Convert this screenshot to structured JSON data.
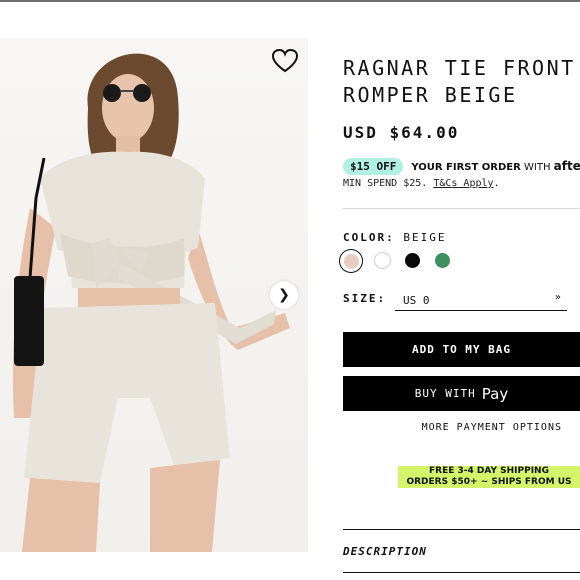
{
  "product": {
    "title": "RAGNAR TIE FRONT ROMPER BEIGE",
    "price": "USD $64.00"
  },
  "promo": {
    "badge": "$15 OFF",
    "text_prefix": "YOUR FIRST ORDER",
    "text_with": " WITH ",
    "brand": "afterp",
    "min_spend": "MIN SPEND $25.",
    "tcs_link": "T&Cs Apply",
    "tcs_end": "."
  },
  "color": {
    "label": "COLOR:",
    "selected": "BEIGE",
    "swatches": [
      "#e6cdbf",
      "#ffffff",
      "#0b0b0b",
      "#3f8f5f"
    ]
  },
  "size": {
    "label": "SIZE:",
    "value": "US 0",
    "chevron": "»"
  },
  "buttons": {
    "add_to_bag": "ADD TO MY BAG",
    "buy_with": "BUY WITH",
    "apple_pay": " Pay",
    "more_payment": "MORE PAYMENT OPTIONS",
    "next_arrow": "❯"
  },
  "shipping": {
    "line1": "FREE 3-4 DAY SHIPPING",
    "line2": "ORDERS $50+ ~ SHIPS FROM US"
  },
  "description_label": "DESCRIPTION"
}
